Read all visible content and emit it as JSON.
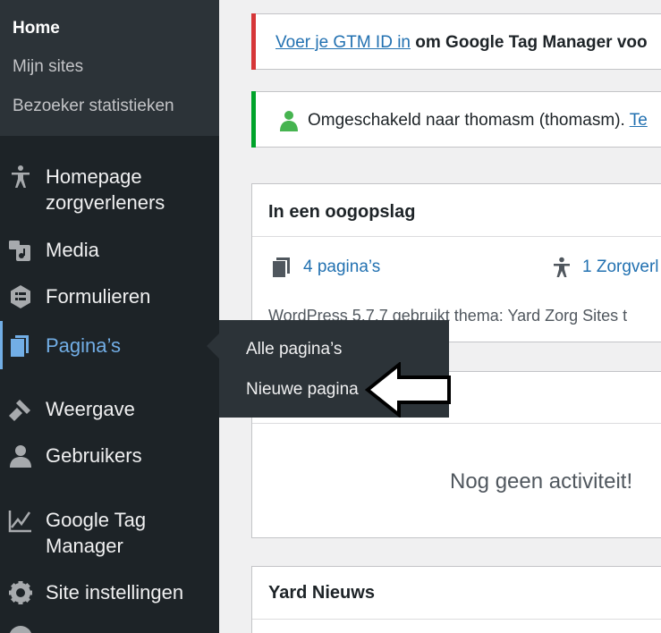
{
  "sidebar": {
    "sub_items": [
      "Home",
      "Mijn sites",
      "Bezoeker statistieken"
    ],
    "menu": [
      {
        "label_line1": "Homepage",
        "label_line2": "zorgverleners",
        "icon": "accessibility-icon"
      },
      {
        "label_line1": "Media",
        "icon": "media-icon"
      },
      {
        "label_line1": "Formulieren",
        "icon": "forms-icon"
      },
      {
        "label_line1": "Pagina’s",
        "icon": "pages-icon"
      },
      {
        "label_line1": "Weergave",
        "icon": "appearance-icon"
      },
      {
        "label_line1": "Gebruikers",
        "icon": "users-icon"
      },
      {
        "label_line1": "Google Tag",
        "label_line2": "Manager",
        "icon": "chart-icon"
      },
      {
        "label_line1": "Site instellingen",
        "icon": "gear-icon"
      }
    ]
  },
  "flyout": {
    "items": [
      "Alle pagina’s",
      "Nieuwe pagina"
    ]
  },
  "notices": {
    "gtm_link": "Voer je GTM ID in",
    "gtm_text": " om Google Tag Manager voo",
    "switched_text": "Omgeschakeld naar thomasm (thomasm). ",
    "switched_link": "Te"
  },
  "glance": {
    "title": "In een oogopslag",
    "pages": "4 pagina’s",
    "zorg": "1 Zorgverl",
    "wordpress": "WordPress 5.7.7 gebruikt thema: Yard Zorg Sites t"
  },
  "activity": {
    "empty": "Nog geen activiteit!"
  },
  "news": {
    "title": "Yard Nieuws"
  },
  "colors": {
    "sidebar": "#1d2327",
    "accent": "#72aee6",
    "link": "#2271b1",
    "error": "#d63638",
    "success": "#00a32a"
  }
}
